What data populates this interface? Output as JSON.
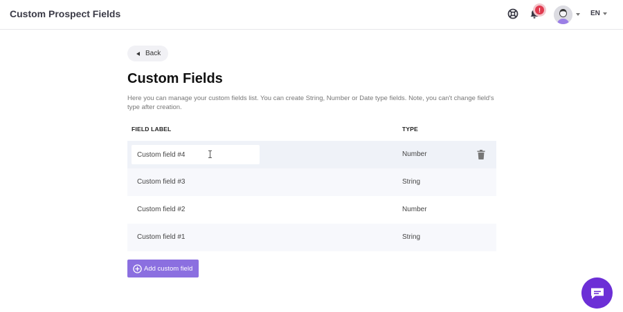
{
  "header": {
    "title": "Custom Prospect Fields",
    "help_icon": "lifebuoy-icon",
    "notifications_icon": "bell-icon",
    "notifications_badge": "!",
    "avatar_icon": "user-avatar",
    "language": "EN"
  },
  "main": {
    "back_label": "Back",
    "title": "Custom Fields",
    "description": "Here you can manage your custom fields list. You can create String, Number or Date type fields. Note, you can't change field's type after creation.",
    "columns": {
      "label": "FIELD LABEL",
      "type": "TYPE"
    },
    "rows": [
      {
        "label": "Custom field #4",
        "type": "Number"
      },
      {
        "label": "Custom field #3",
        "type": "String"
      },
      {
        "label": "Custom field #2",
        "type": "Number"
      },
      {
        "label": "Custom field #1",
        "type": "String"
      }
    ],
    "add_label": "Add custom field"
  },
  "colors": {
    "accent": "#8b6fe0",
    "chat": "#6c2fd6",
    "badge": "#e03a4f"
  }
}
